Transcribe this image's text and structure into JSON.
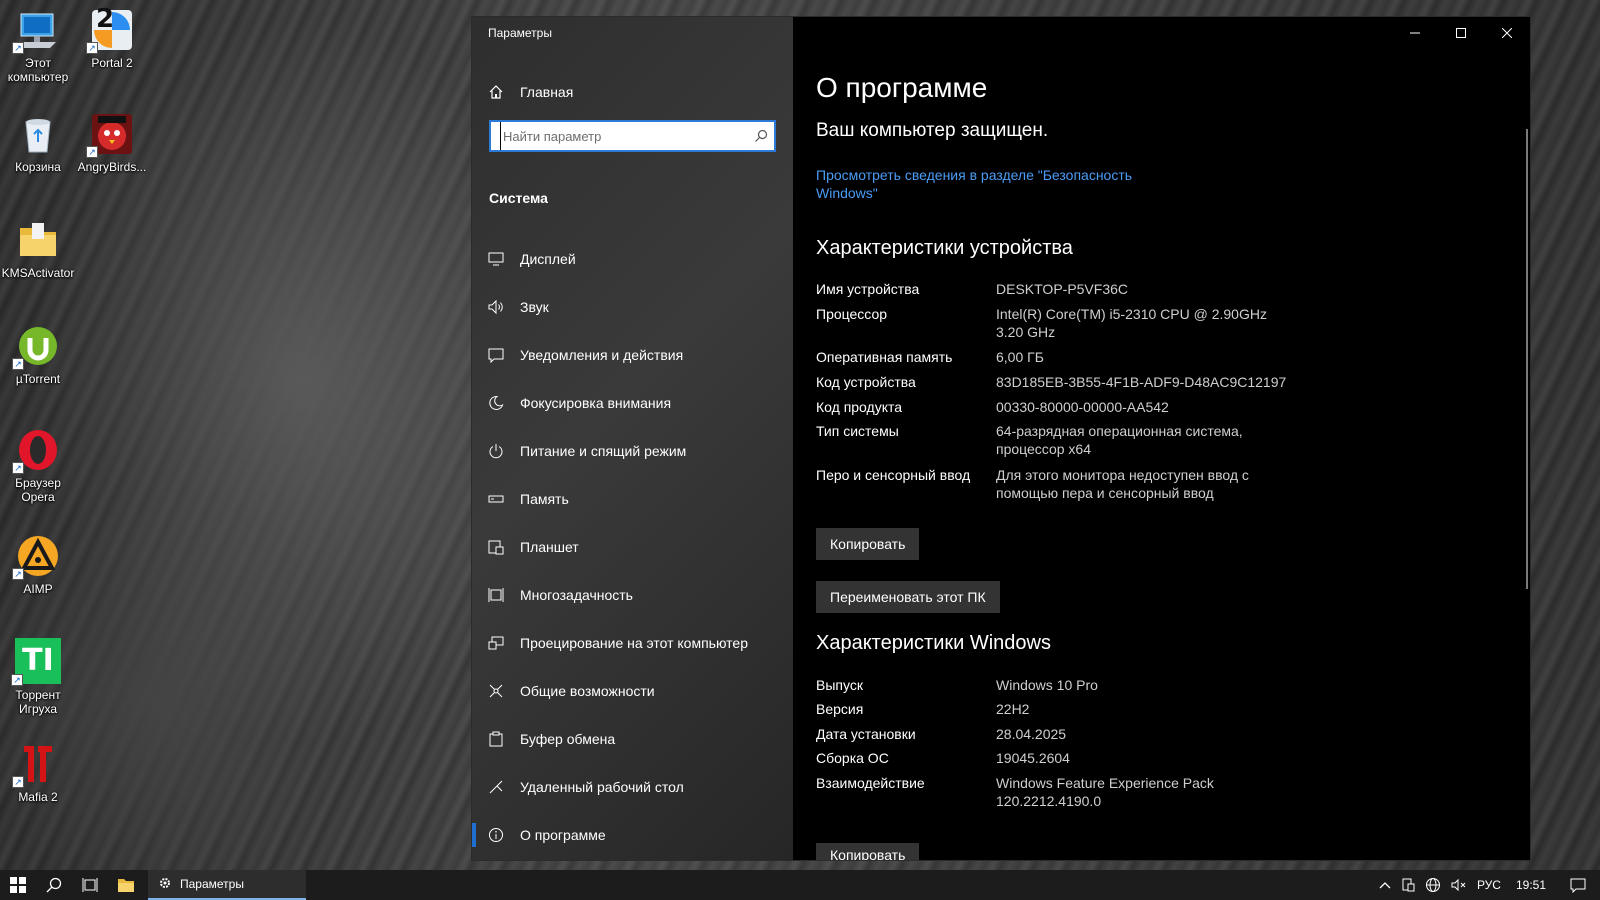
{
  "desktop": {
    "icons": [
      {
        "label": "Этот компьютер",
        "icon": "computer-icon"
      },
      {
        "label": "Portal 2",
        "icon": "portal2-icon"
      },
      {
        "label": "Корзина",
        "icon": "recycle-bin-icon"
      },
      {
        "label": "AngryBirds...",
        "icon": "angrybirds-icon"
      },
      {
        "label": "KMSActivator",
        "icon": "folder-icon"
      },
      {
        "label": "µTorrent",
        "icon": "utorrent-icon"
      },
      {
        "label": "Браузер Opera",
        "icon": "opera-icon"
      },
      {
        "label": "AIMP",
        "icon": "aimp-icon"
      },
      {
        "label": "Торрент Игруха",
        "icon": "torrent-igruha-icon"
      },
      {
        "label": "Mafia 2",
        "icon": "mafia2-icon"
      }
    ],
    "portal2_glyph": "2",
    "torrent_glyph": "TI"
  },
  "window": {
    "title": "Параметры",
    "home_label": "Главная",
    "search_placeholder": "Найти параметр",
    "section_title": "Система",
    "nav": [
      {
        "label": "Дисплей",
        "icon": "display-icon"
      },
      {
        "label": "Звук",
        "icon": "sound-icon"
      },
      {
        "label": "Уведомления и действия",
        "icon": "notifications-icon"
      },
      {
        "label": "Фокусировка внимания",
        "icon": "focus-assist-icon"
      },
      {
        "label": "Питание и спящий режим",
        "icon": "power-icon"
      },
      {
        "label": "Память",
        "icon": "storage-icon"
      },
      {
        "label": "Планшет",
        "icon": "tablet-icon"
      },
      {
        "label": "Многозадачность",
        "icon": "multitasking-icon"
      },
      {
        "label": "Проецирование на этот компьютер",
        "icon": "projecting-icon"
      },
      {
        "label": "Общие возможности",
        "icon": "shared-experiences-icon"
      },
      {
        "label": "Буфер обмена",
        "icon": "clipboard-icon"
      },
      {
        "label": "Удаленный рабочий стол",
        "icon": "remote-desktop-icon"
      },
      {
        "label": "О программе",
        "icon": "info-icon",
        "active": true
      }
    ],
    "content": {
      "title": "О программе",
      "protected_text": "Ваш компьютер защищен.",
      "security_link": "Просмотреть сведения в разделе \"Безопасность Windows\"",
      "device_heading": "Характеристики устройства",
      "device_specs": [
        {
          "key": "Имя устройства",
          "value": "DESKTOP-P5VF36C"
        },
        {
          "key": "Процессор",
          "value": "Intel(R) Core(TM) i5-2310 CPU @ 2.90GHz 3.20 GHz"
        },
        {
          "key": "Оперативная память",
          "value": "6,00 ГБ"
        },
        {
          "key": "Код устройства",
          "value": "83D185EB-3B55-4F1B-ADF9-D48AC9C12197"
        },
        {
          "key": "Код продукта",
          "value": "00330-80000-00000-AA542"
        },
        {
          "key": "Тип системы",
          "value": "64-разрядная операционная система, процессор x64"
        },
        {
          "key": "Перо и сенсорный ввод",
          "value": "Для этого монитора недоступен ввод с помощью пера и сенсорный ввод"
        }
      ],
      "copy_button": "Копировать",
      "rename_button": "Переименовать этот ПК",
      "windows_heading": "Характеристики Windows",
      "windows_specs": [
        {
          "key": "Выпуск",
          "value": "Windows 10 Pro"
        },
        {
          "key": "Версия",
          "value": "22H2"
        },
        {
          "key": "Дата установки",
          "value": "28.04.2025"
        },
        {
          "key": "Сборка ОС",
          "value": "19045.2604"
        },
        {
          "key": "Взаимодействие",
          "value": "Windows Feature Experience Pack 120.2212.4190.0"
        }
      ],
      "copy_button_2": "Копировать"
    }
  },
  "taskbar": {
    "app_label": "Параметры",
    "language": "РУС",
    "time": "19:51"
  },
  "colors": {
    "accent": "#1f6fd1",
    "link": "#4a9cf5",
    "window_bg": "#000000",
    "nav_bg": "#333333",
    "taskbar_bg": "#1c1c1c"
  }
}
